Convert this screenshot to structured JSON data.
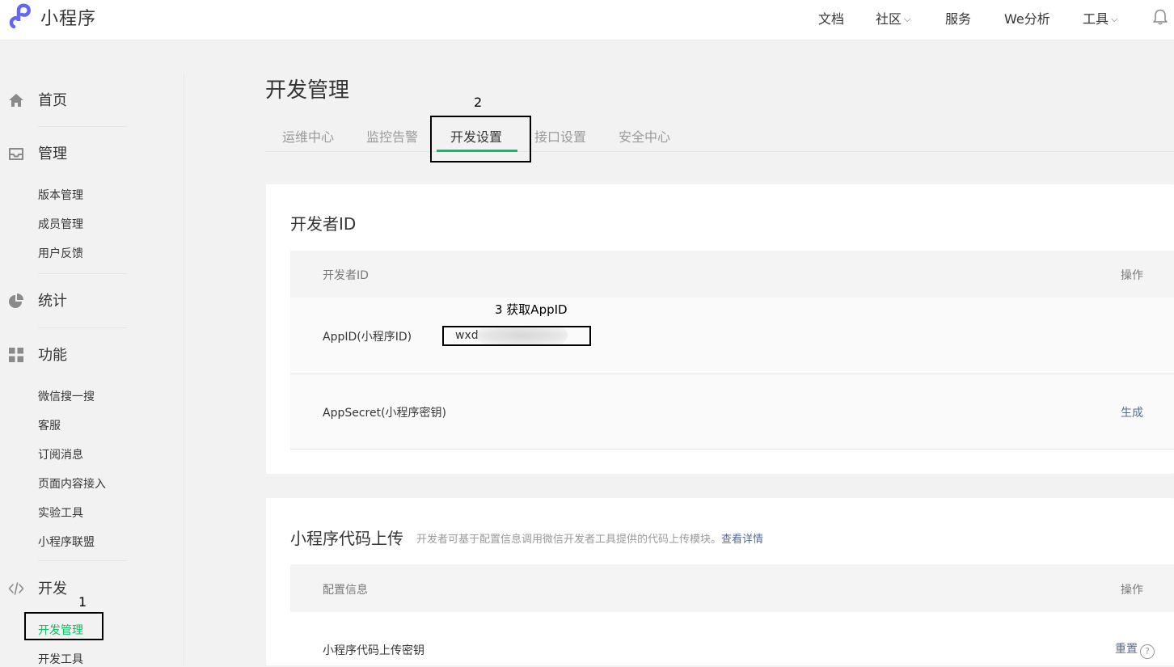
{
  "header": {
    "brand": "小程序",
    "nav": [
      {
        "label": "文档",
        "has_dropdown": false
      },
      {
        "label": "社区",
        "has_dropdown": true
      },
      {
        "label": "服务",
        "has_dropdown": false
      },
      {
        "label": "We分析",
        "has_dropdown": false
      },
      {
        "label": "工具",
        "has_dropdown": true
      }
    ],
    "icons": {
      "logo": "mini-program-logo-icon",
      "bell": "bell-icon"
    }
  },
  "sidebar": {
    "groups": [
      {
        "label": "首页",
        "icon": "home-icon",
        "items": []
      },
      {
        "label": "管理",
        "icon": "inbox-icon",
        "items": [
          "版本管理",
          "成员管理",
          "用户反馈"
        ]
      },
      {
        "label": "统计",
        "icon": "pie-chart-icon",
        "items": []
      },
      {
        "label": "功能",
        "icon": "grid-icon",
        "items": [
          "微信搜一搜",
          "客服",
          "订阅消息",
          "页面内容接入",
          "实验工具",
          "小程序联盟"
        ]
      },
      {
        "label": "开发",
        "icon": "code-icon",
        "items": [
          "开发管理",
          "开发工具"
        ]
      }
    ],
    "active_item": "开发管理"
  },
  "main": {
    "title": "开发管理",
    "tabs": [
      "运维中心",
      "监控告警",
      "开发设置",
      "接口设置",
      "安全中心"
    ],
    "active_tab": "开发设置",
    "developer_card": {
      "title": "开发者ID",
      "col_name": "开发者ID",
      "col_action": "操作",
      "rows": [
        {
          "label": "AppID(小程序ID)",
          "value": "wxd",
          "action": ""
        },
        {
          "label": "AppSecret(小程序密钥)",
          "value": "",
          "action": "生成"
        }
      ]
    },
    "upload_card": {
      "title": "小程序代码上传",
      "desc": "开发者可基于配置信息调用微信开发者工具提供的代码上传模块。",
      "desc_link": "查看详情",
      "col_name": "配置信息",
      "col_action": "操作",
      "rows": [
        {
          "label": "小程序代码上传密钥",
          "action": "重置",
          "help": "?"
        }
      ]
    }
  },
  "annotations": {
    "step1": "1",
    "step2": "2",
    "step3": "3 获取AppID"
  },
  "colors": {
    "accent_green": "#07c160",
    "link_blue": "#576b95",
    "brand_purple": "#6467f0"
  }
}
